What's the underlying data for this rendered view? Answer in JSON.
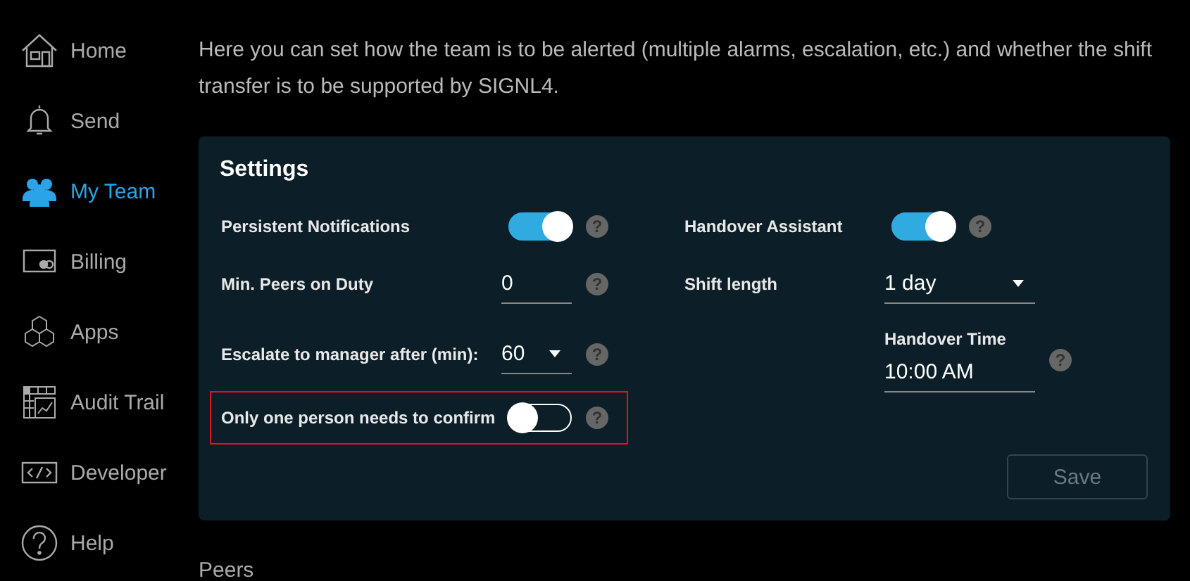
{
  "sidebar": {
    "items": [
      {
        "kind": "home",
        "label": "Home",
        "selected": false
      },
      {
        "kind": "bell",
        "label": "Send",
        "selected": false
      },
      {
        "kind": "team",
        "label": "My Team",
        "selected": true
      },
      {
        "kind": "card",
        "label": "Billing",
        "selected": false
      },
      {
        "kind": "cubes",
        "label": "Apps",
        "selected": false
      },
      {
        "kind": "grid",
        "label": "Audit Trail",
        "selected": false
      },
      {
        "kind": "code",
        "label": "Developer",
        "selected": false
      },
      {
        "kind": "help",
        "label": "Help",
        "selected": false
      }
    ]
  },
  "intro": "Here you can set how the team is to be alerted (multiple alarms, escalation, etc.) and whether the shift transfer is to be supported by SIGNL4.",
  "settings": {
    "title": "Settings",
    "left": [
      {
        "kind": "toggle",
        "label": "Persistent Notifications",
        "on": true,
        "help": "?",
        "highlighted": false
      },
      {
        "kind": "input",
        "label": "Min. Peers on Duty",
        "value": "0",
        "help": "?",
        "highlighted": false
      },
      {
        "kind": "select",
        "label": "Escalate to manager after (min):",
        "value": "60",
        "help": "?",
        "highlighted": false
      },
      {
        "kind": "toggle",
        "label": "Only one person needs to confirm",
        "on": false,
        "help": "?",
        "highlighted": true
      }
    ],
    "right": [
      {
        "kind": "toggle",
        "label": "Handover Assistant",
        "on": true,
        "help": "?"
      },
      {
        "kind": "select",
        "label": "Shift length",
        "value": "1 day"
      },
      {
        "kind": "timefield",
        "label": "Handover Time",
        "value": "10:00 AM",
        "help": "?"
      }
    ],
    "save_button": {
      "label": "Save",
      "disabled": true
    }
  },
  "peers": {
    "title": "Peers"
  }
}
